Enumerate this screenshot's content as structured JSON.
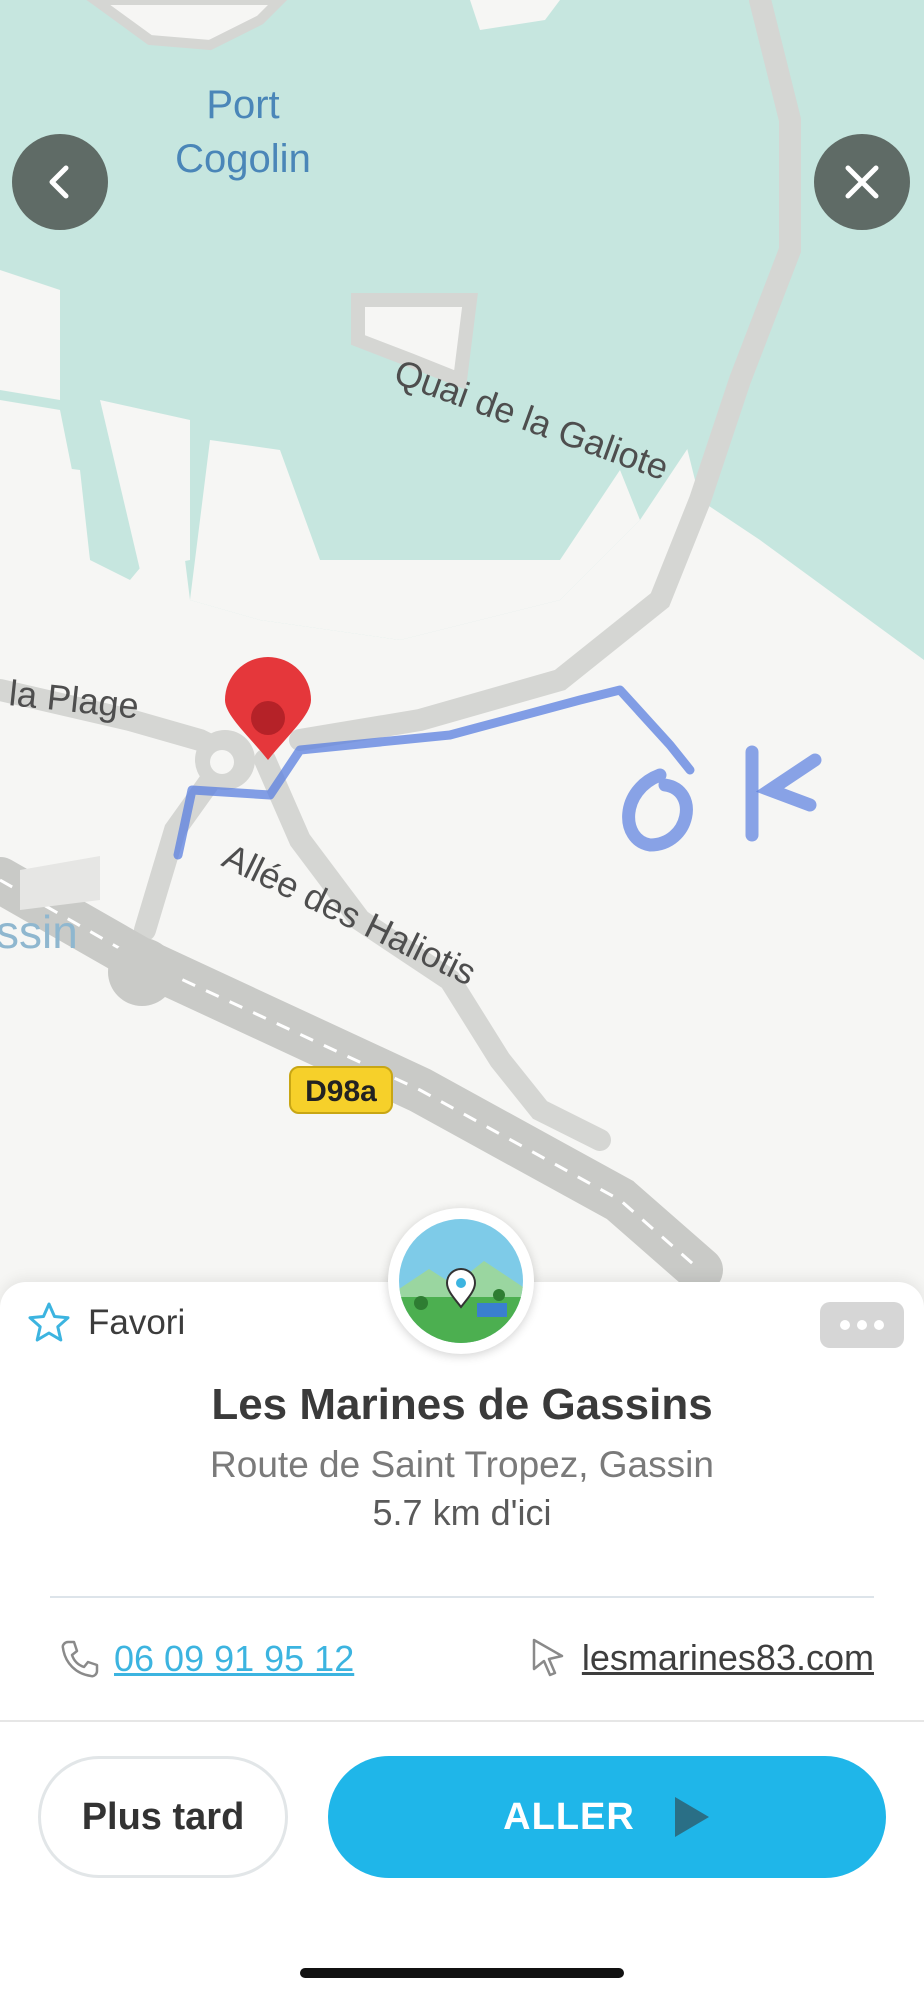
{
  "map": {
    "labels": {
      "port_line1": "Port",
      "port_line2": "Cogolin",
      "quai": "Quai de la Galiote",
      "plage": "la Plage",
      "allee": "Allée des Haliotis",
      "gassin_partial": "ssin",
      "road_badge": "D98a"
    },
    "annotation": "ok",
    "colors": {
      "water": "#c6e6df",
      "land": "#f6f6f4",
      "road": "#d5d6d3",
      "route": "#5a7fe0",
      "pin": "#e5373b",
      "badge": "#f6d02a"
    }
  },
  "nav": {
    "back_icon": "chevron-left-icon",
    "close_icon": "close-icon"
  },
  "place": {
    "favorite_label": "Favori",
    "title": "Les Marines de Gassins",
    "address": "Route de Saint Tropez, Gassin",
    "distance": "5.7 km d'ici",
    "phone": "06 09 91 95 12",
    "website": "lesmarines83.com"
  },
  "actions": {
    "later_label": "Plus tard",
    "go_label": "ALLER"
  },
  "colors": {
    "accent": "#1fb6e9",
    "link": "#3cb4e0"
  }
}
